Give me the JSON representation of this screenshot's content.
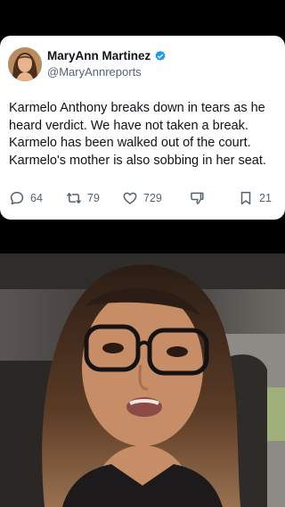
{
  "tweet": {
    "display_name": "MaryAnn Martinez",
    "handle": "@MaryAnnreports",
    "text": "Karmelo Anthony breaks down in tears as he heard verdict. We have not taken a break. Karmelo has been walked out of the court. Karmelo's mother is also sobbing in her seat.",
    "verified_color": "#1d9bf0",
    "actions": {
      "replies": "64",
      "retweets": "79",
      "likes": "729",
      "bookmarks": "21"
    },
    "icons": {
      "reply": "reply-icon",
      "retweet": "retweet-icon",
      "like": "heart-icon",
      "views": "thumbs-down-icon",
      "bookmark": "bookmark-icon"
    }
  },
  "video": {
    "description_icon": "webcam-video-frame"
  }
}
